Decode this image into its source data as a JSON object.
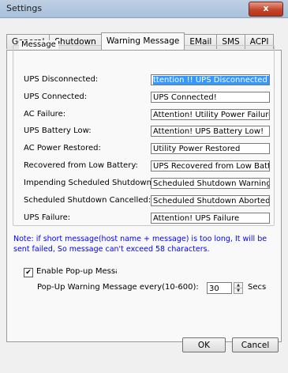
{
  "window": {
    "title": "Settings",
    "close_label": "x"
  },
  "tabs": [
    {
      "label": "General",
      "active": false
    },
    {
      "label": "Shutdown",
      "active": false
    },
    {
      "label": "Warning Message",
      "active": true
    },
    {
      "label": "EMail",
      "active": false
    },
    {
      "label": "SMS",
      "active": false
    },
    {
      "label": "ACPI",
      "active": false
    }
  ],
  "message_group": {
    "legend": "Message",
    "rows": [
      {
        "label": "UPS Disconnected:",
        "value": "ttention !! UPS Disconnected !"
      },
      {
        "label": "UPS Connected:",
        "value": "UPS Connected!"
      },
      {
        "label": "AC Failure:",
        "value": "Attention! Utility Power Failure!"
      },
      {
        "label": "UPS Battery Low:",
        "value": "Attention! UPS Battery Low!"
      },
      {
        "label": "AC Power Restored:",
        "value": "Utility Power Restored"
      },
      {
        "label": "Recovered from Low Battery:",
        "value": "UPS Recovered from Low Batt"
      },
      {
        "label": "Impending Scheduled Shutdown:",
        "value": "Scheduled Shutdown Warning"
      },
      {
        "label": "Scheduled Shutdown Cancelled:",
        "value": "Scheduled Shutdown Aborted"
      },
      {
        "label": "UPS Failure:",
        "value": "Attention! UPS Failure"
      }
    ]
  },
  "note": "Note: if short message(host name + message) is too long, It will be sent failed, So message can't exceed 58 characters.",
  "popup": {
    "enable_label": "Enable Pop-up Messag",
    "checked": true,
    "interval_label": "Pop-Up Warning Message every(10-600):",
    "interval_value": "30",
    "units": "Secs"
  },
  "buttons": {
    "ok": "OK",
    "cancel": "Cancel"
  },
  "colors": {
    "note": "#0000ff",
    "selection": "#3399ff",
    "close_button": "#c3452b"
  }
}
